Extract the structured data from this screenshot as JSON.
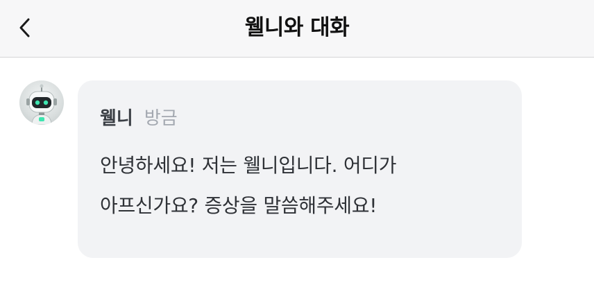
{
  "header": {
    "title": "웰니와 대화",
    "back_icon": "chevron-left-icon"
  },
  "message": {
    "avatar_icon": "robot-avatar",
    "sender": "웰니",
    "time": "방금",
    "lines": [
      "안녕하세요! 저는 웰니입니다. 어디가",
      "아프신가요? 증상을 말씀해주세요!"
    ]
  },
  "colors": {
    "header_bg": "#f7f7f8",
    "bubble_bg": "#f2f3f5",
    "title_text": "#111111",
    "sender_text": "#3b3f45",
    "time_text": "#a3a8b0",
    "message_text": "#2e3136",
    "robot_eye": "#3ee6b0"
  }
}
